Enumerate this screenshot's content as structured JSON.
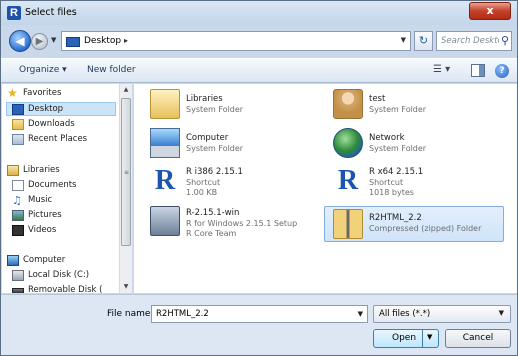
{
  "window": {
    "title": "Select files",
    "close_label": "x",
    "app_icon_letter": "R"
  },
  "address": {
    "location": "Desktop",
    "separator": "▸",
    "search_placeholder": "Search Desktop"
  },
  "toolbar": {
    "organize_label": "Organize ▾",
    "new_folder_label": "New folder"
  },
  "sidebar": {
    "favorites": {
      "label": "Favorites",
      "icon": "star-icon"
    },
    "favorites_items": [
      {
        "label": "Desktop",
        "icon": "desktop-icon",
        "selected": true
      },
      {
        "label": "Downloads",
        "icon": "downloads-folder-icon"
      },
      {
        "label": "Recent Places",
        "icon": "recent-places-icon"
      }
    ],
    "libraries": {
      "label": "Libraries",
      "icon": "libraries-icon"
    },
    "libraries_items": [
      {
        "label": "Documents",
        "icon": "documents-icon"
      },
      {
        "label": "Music",
        "icon": "music-icon"
      },
      {
        "label": "Pictures",
        "icon": "pictures-icon"
      },
      {
        "label": "Videos",
        "icon": "videos-icon"
      }
    ],
    "computer": {
      "label": "Computer",
      "icon": "computer-icon"
    },
    "computer_items": [
      {
        "label": "Local Disk (C:)",
        "icon": "local-disk-icon"
      },
      {
        "label": "Removable Disk (",
        "icon": "removable-disk-icon"
      }
    ]
  },
  "files": [
    {
      "name": "Libraries",
      "line1": "System Folder",
      "line2": "",
      "icon": "libraries-folder-icon"
    },
    {
      "name": "test",
      "line1": "System Folder",
      "line2": "",
      "icon": "user-folder-icon"
    },
    {
      "name": "Computer",
      "line1": "System Folder",
      "line2": "",
      "icon": "computer-icon"
    },
    {
      "name": "Network",
      "line1": "System Folder",
      "line2": "",
      "icon": "network-icon"
    },
    {
      "name": "R i386 2.15.1",
      "line1": "Shortcut",
      "line2": "1.00 KB",
      "icon": "r-shortcut-icon"
    },
    {
      "name": "R x64 2.15.1",
      "line1": "Shortcut",
      "line2": "1018 bytes",
      "icon": "r-shortcut-icon"
    },
    {
      "name": "R-2.15.1-win",
      "line1": "R for Windows 2.15.1 Setup",
      "line2": "R Core Team",
      "icon": "r-setup-icon"
    },
    {
      "name": "R2HTML_2.2",
      "line1": "Compressed (zipped) Folder",
      "line2": "",
      "icon": "zip-folder-icon",
      "selected": true
    }
  ],
  "footer": {
    "file_name_label": "File name:",
    "file_name_value": "R2HTML_2.2",
    "filter_value": "All files (*.*)",
    "open_label": "Open",
    "cancel_label": "Cancel"
  }
}
